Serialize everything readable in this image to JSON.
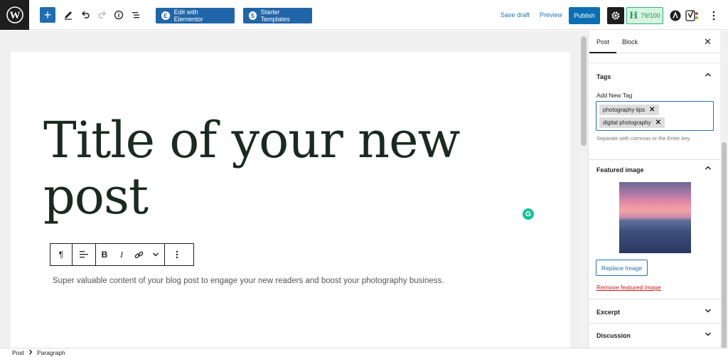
{
  "toolbar": {
    "add_icon": "plus-icon",
    "elementor_label": "Edit with Elementor",
    "starter_label": "Starter Templates",
    "save_draft": "Save draft",
    "preview": "Preview",
    "publish": "Publish",
    "seo_score": "79/100",
    "seo_logo": "H"
  },
  "editor": {
    "title": "Title of your new post",
    "paragraph": "Super valuable content of your blog post to engage your new readers and boost your photography business.",
    "grammarly_glyph": "G"
  },
  "sidebar": {
    "tabs": [
      "Post",
      "Block"
    ],
    "tags": {
      "heading": "Tags",
      "add_label": "Add New Tag",
      "items": [
        "photography tips",
        "digital photography"
      ],
      "help": "Separate with commas or the Enter key."
    },
    "featured": {
      "heading": "Featured image",
      "replace": "Replace Image",
      "remove": "Remove featured image"
    },
    "excerpt": "Excerpt",
    "discussion": "Discussion"
  },
  "breadcrumb": [
    "Post",
    "Paragraph"
  ],
  "colors": {
    "primary": "#2271b1",
    "publish": "#0a6fb3",
    "elementor": "#2065a8",
    "seo_green": "#2bb673"
  }
}
